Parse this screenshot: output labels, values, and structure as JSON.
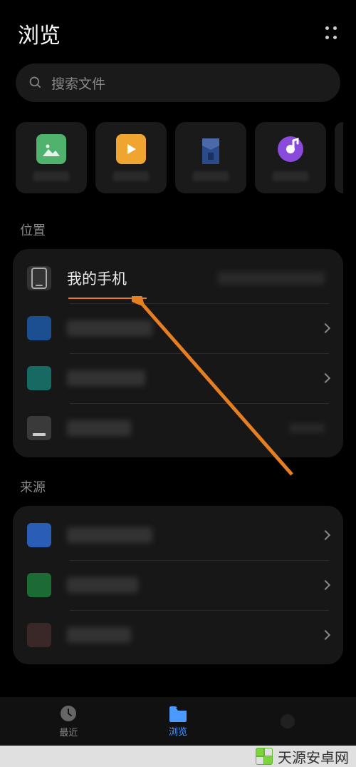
{
  "header": {
    "title": "浏览"
  },
  "search": {
    "placeholder": "搜索文件"
  },
  "categories": {
    "items": [
      {
        "icon": "image",
        "color": "#4fb36e"
      },
      {
        "icon": "video",
        "color": "#f0a530"
      },
      {
        "icon": "archive",
        "color": "#2a4a8a"
      },
      {
        "icon": "audio",
        "color": "#8a4adb"
      }
    ]
  },
  "sections": {
    "location_label": "位置",
    "source_label": "来源"
  },
  "locations": {
    "items": [
      {
        "label": "我的手机",
        "icon": "phone",
        "has_meta": true
      },
      {
        "label": "",
        "icon": "sd",
        "color": "#1c4f92",
        "chevron": true
      },
      {
        "label": "",
        "icon": "vault",
        "color": "#176a62",
        "chevron": true
      },
      {
        "label": "",
        "icon": "trash",
        "color": "#3a3a3a",
        "has_meta": true
      }
    ]
  },
  "sources": {
    "items": [
      {
        "color": "#2a5db5"
      },
      {
        "color": "#1d6b34"
      },
      {
        "color": "#5a2c2c"
      }
    ]
  },
  "nav": {
    "recent": "最近",
    "browse": "浏览"
  },
  "watermark": {
    "text": "天源安卓网",
    "url": "www.jytyaz.com"
  },
  "colors": {
    "accent": "#e67e22",
    "active": "#4b9aff"
  }
}
